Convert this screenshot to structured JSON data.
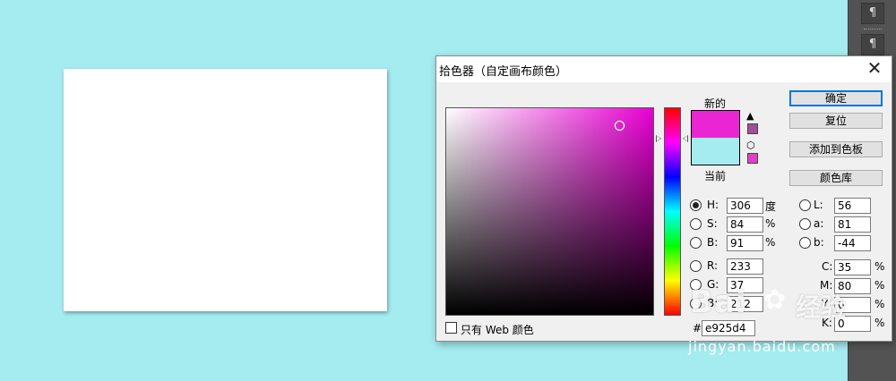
{
  "side_panel": {
    "icons": [
      "pilcrow-icon",
      "paragraph-styles-icon"
    ],
    "glyph_1": "¶",
    "glyph_2": "¶"
  },
  "dialog": {
    "title": "拾色器（自定画布颜色）",
    "close_glyph": "✕",
    "label_new": "新的",
    "label_current": "当前",
    "new_color": "#e925d4",
    "current_color": "#a4ecf0",
    "warn_glyph": "▲",
    "cube_glyph": "⬡",
    "warn_swatch_color": "#a0509c",
    "cube_swatch_color": "#e63cc8",
    "buttons": {
      "ok": "确定",
      "reset": "复位",
      "add_to_swatches": "添加到色板",
      "color_libraries": "颜色库"
    },
    "hsb": {
      "h_label": "H:",
      "h_value": "306",
      "h_unit": "度",
      "s_label": "S:",
      "s_value": "84",
      "s_unit": "%",
      "b_label": "B:",
      "b_value": "91",
      "b_unit": "%"
    },
    "rgb": {
      "r_label": "R:",
      "r_value": "233",
      "g_label": "G:",
      "g_value": "37",
      "b_label": "B:",
      "b_value": "212"
    },
    "lab": {
      "l_label": "L:",
      "l_value": "56",
      "a_label": "a:",
      "a_value": "81",
      "b_label": "b:",
      "b_value": "-44"
    },
    "cmyk": {
      "c_label": "C:",
      "c_value": "35",
      "c_unit": "%",
      "m_label": "M:",
      "m_value": "80",
      "m_unit": "%",
      "y_label": "Y:",
      "y_value": "0",
      "y_unit": "%",
      "k_label": "K:",
      "k_value": "0",
      "k_unit": "%"
    },
    "hex_label": "#",
    "hex_value": "e925d4",
    "web_only_label": "只有 Web 颜色"
  },
  "watermark": {
    "logo": "Bai",
    "paw": "✿",
    "brand": "经验",
    "url": "jingyan.baidu.com"
  }
}
